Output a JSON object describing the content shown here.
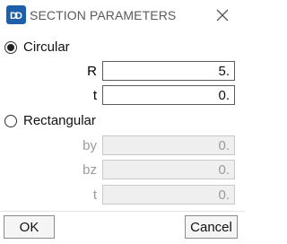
{
  "window": {
    "title": "SECTION PARAMETERS",
    "icon": "app-logo-icon",
    "close_icon": "close-icon"
  },
  "circular": {
    "label": "Circular",
    "selected": true,
    "fields": [
      {
        "label": "R",
        "value": "5."
      },
      {
        "label": "t",
        "value": "0."
      }
    ]
  },
  "rectangular": {
    "label": "Rectangular",
    "selected": false,
    "fields": [
      {
        "label": "by",
        "value": "0."
      },
      {
        "label": "bz",
        "value": "0."
      },
      {
        "label": "t",
        "value": "0."
      }
    ]
  },
  "buttons": {
    "ok": "OK",
    "cancel": "Cancel"
  },
  "colors": {
    "app_icon": "#1d5fa8",
    "disabled_text": "#9a9a9a",
    "disabled_field_bg": "#efefef"
  }
}
